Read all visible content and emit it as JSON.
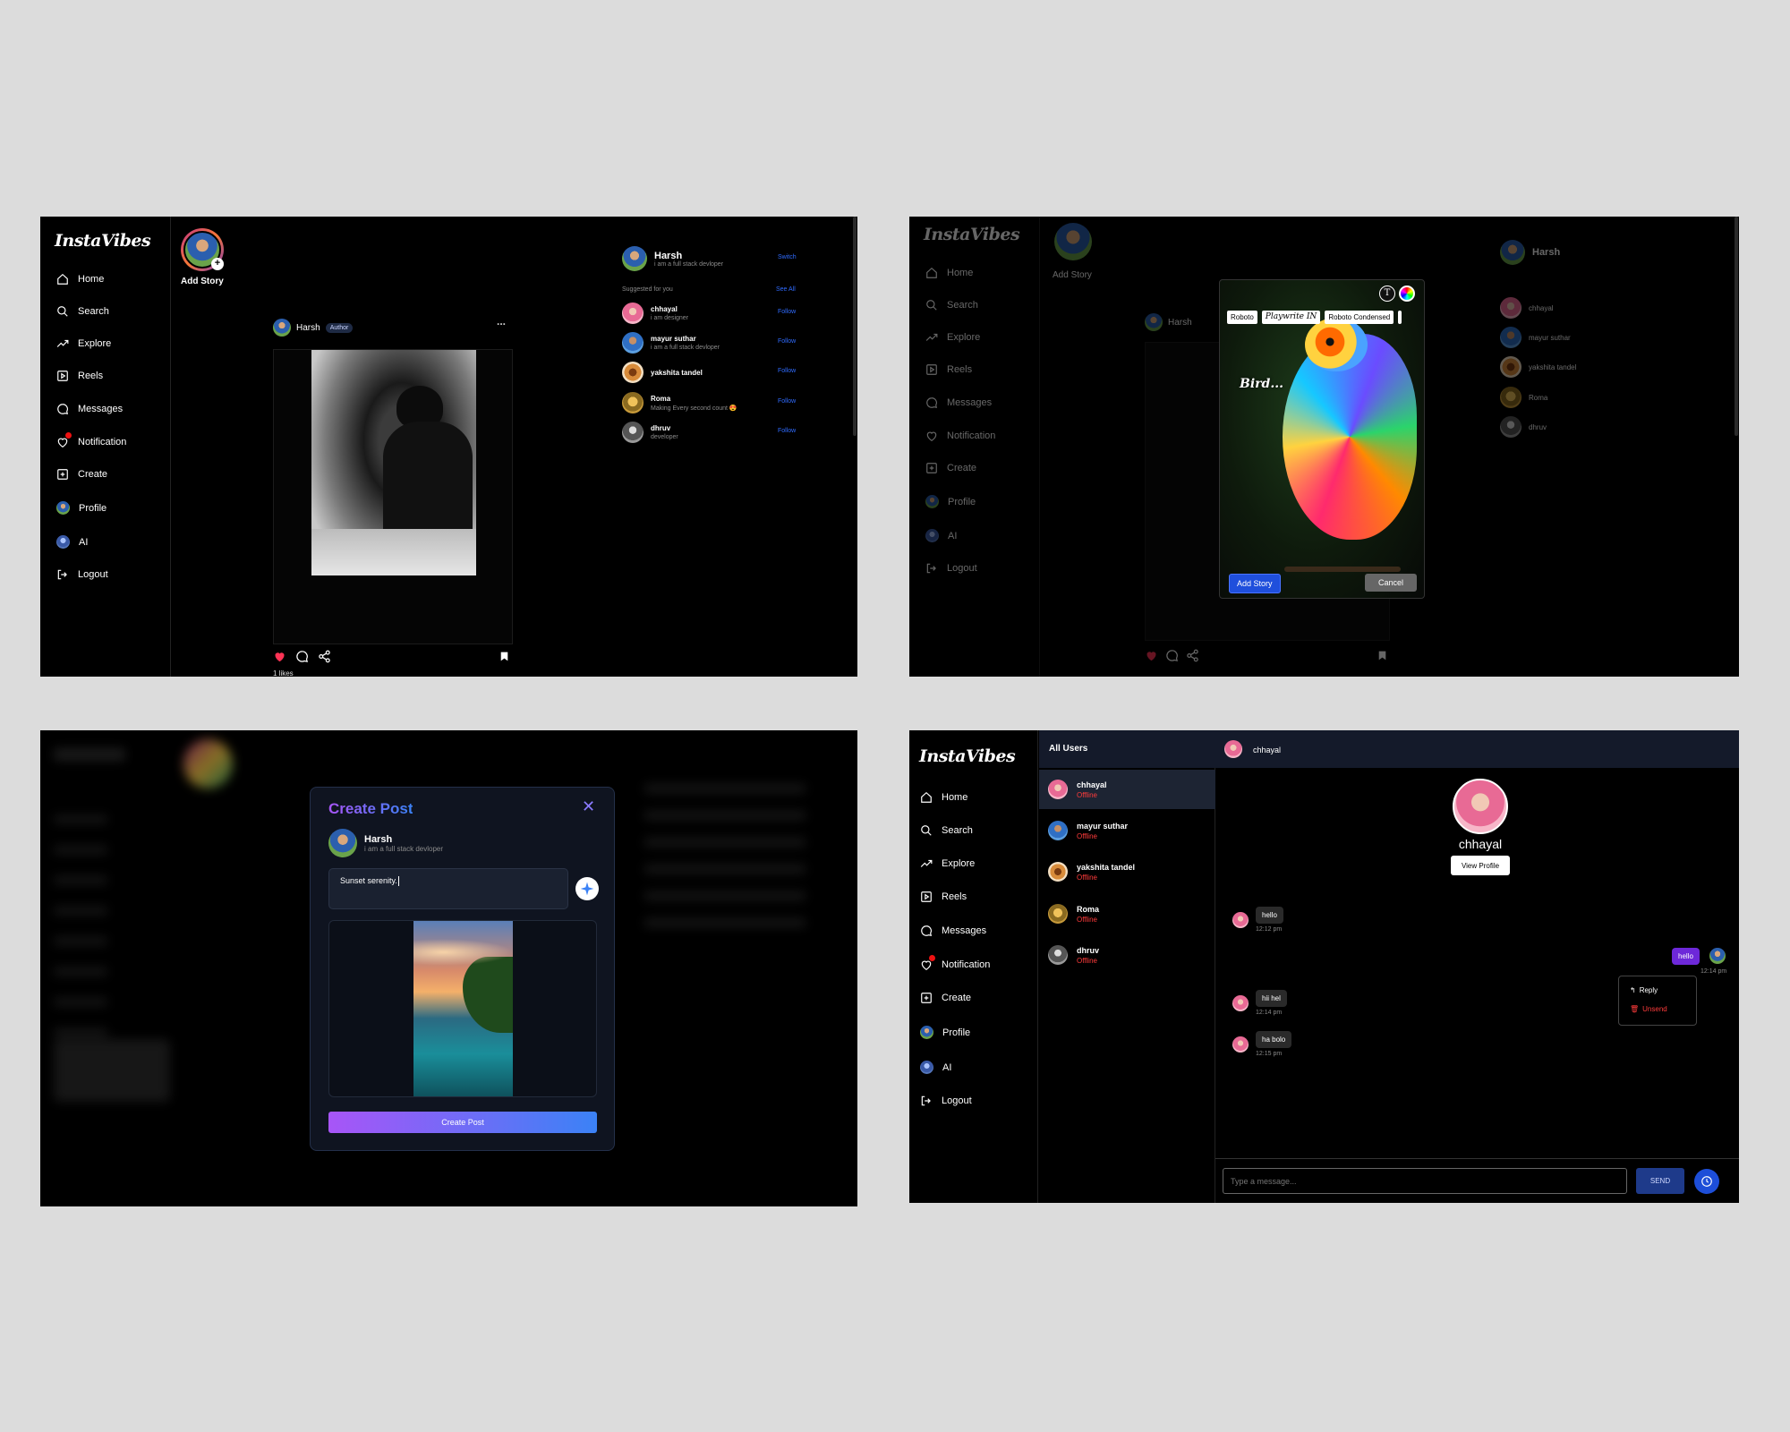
{
  "brand": "InstaVibes",
  "nav": {
    "home": "Home",
    "search": "Search",
    "explore": "Explore",
    "reels": "Reels",
    "messages": "Messages",
    "notification": "Notification",
    "create": "Create",
    "profile": "Profile",
    "ai": "AI",
    "logout": "Logout"
  },
  "story": {
    "add_label": "Add Story"
  },
  "feed_post": {
    "author": "Harsh",
    "badge": "Author",
    "more": "...",
    "likes": "1 likes"
  },
  "right_panel": {
    "user_name": "Harsh",
    "user_bio": "i am a full stack devloper",
    "switch": "Switch",
    "suggested_heading": "Suggested for you",
    "see_all": "See All",
    "suggestions": [
      {
        "name": "chhayal",
        "bio": "i am designer",
        "action": "Follow"
      },
      {
        "name": "mayur suthar",
        "bio": "i am a full stack devloper",
        "action": "Follow"
      },
      {
        "name": "yakshita tandel",
        "bio": "",
        "action": "Follow"
      },
      {
        "name": "Roma",
        "bio": "Making Every second count 😍",
        "action": "Follow"
      },
      {
        "name": "dhruv",
        "bio": "developer",
        "action": "Follow"
      }
    ]
  },
  "story_editor": {
    "fonts": [
      "Roboto",
      "Playwrite IN",
      "Roboto Condensed"
    ],
    "overlay_text": "Bird...",
    "add_button": "Add Story",
    "cancel_button": "Cancel",
    "text_tool": "T"
  },
  "create_post": {
    "title": "Create Post",
    "user_name": "Harsh",
    "user_bio": "i am a full stack devloper",
    "caption": "Sunset serenity.",
    "submit": "Create Post"
  },
  "chat": {
    "all_users_heading": "All Users",
    "users": [
      {
        "name": "chhayal",
        "status": "Offline"
      },
      {
        "name": "mayur suthar",
        "status": "Offline"
      },
      {
        "name": "yakshita tandel",
        "status": "Offline"
      },
      {
        "name": "Roma",
        "status": "Offline"
      },
      {
        "name": "dhruv",
        "status": "Offline"
      }
    ],
    "header_name": "chhayal",
    "profile_name": "chhayal",
    "view_profile": "View Profile",
    "messages": [
      {
        "text": "hello",
        "time": "12:12 pm",
        "side": "left"
      },
      {
        "text": "hello",
        "time": "12:14 pm",
        "side": "right"
      },
      {
        "text": "hii hel",
        "time": "12:14 pm",
        "side": "left"
      },
      {
        "text": "ha bolo",
        "time": "12:15 pm",
        "side": "left"
      }
    ],
    "context_menu": {
      "reply": "Reply",
      "unsend": "Unsend"
    },
    "input_placeholder": "Type a message...",
    "send": "SEND"
  },
  "colors": {
    "accent_blue": "#2f6bff",
    "gradient_purple": "#a855f7",
    "gradient_blue": "#3b82f6",
    "offline_red": "#ff3b3b",
    "panel_bg": "#000000",
    "page_bg": "#dcdcdc"
  }
}
